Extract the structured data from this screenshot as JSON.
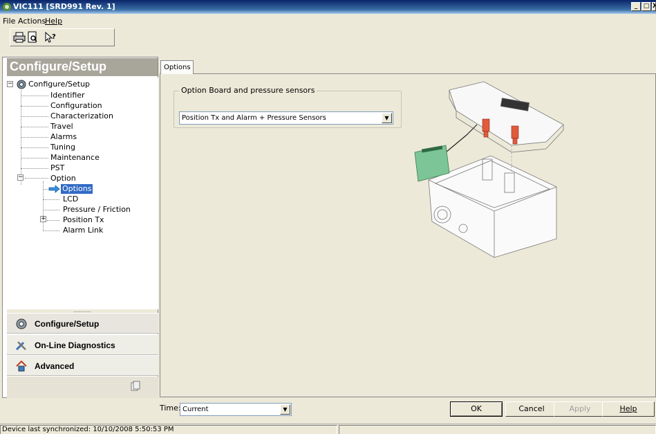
{
  "window": {
    "title": "VIC111 [SRD991 Rev. 1]",
    "minimize": "_",
    "maximize": "□",
    "close": "X"
  },
  "menu": {
    "file": "File",
    "actions": "Actions",
    "help": "Help"
  },
  "toolbar": {
    "print_icon": "printer-icon",
    "preview_icon": "print-preview-icon",
    "whatsthis_icon": "context-help-icon"
  },
  "left": {
    "header": "Configure/Setup",
    "tree": {
      "root": "Configure/Setup",
      "identifier": "Identifier",
      "configuration": "Configuration",
      "characterization": "Characterization",
      "travel": "Travel",
      "alarms": "Alarms",
      "tuning": "Tuning",
      "maintenance": "Maintenance",
      "pst": "PST",
      "option": "Option",
      "options": "Options",
      "lcd": "LCD",
      "pressure": "Pressure / Friction",
      "position_tx": "Position Tx",
      "alarm_link": "Alarm Link"
    },
    "splitter": "..........",
    "nav": {
      "configure": "Configure/Setup",
      "diagnostics": "On-Line Diagnostics",
      "advanced": "Advanced"
    }
  },
  "tab": {
    "options": "Options"
  },
  "group": {
    "label": "Option Board and pressure sensors",
    "select_value": "Position Tx and Alarm + Pressure Sensors"
  },
  "footer": {
    "time_label": "Time:",
    "time_value": "Current",
    "ok": "OK",
    "cancel": "Cancel",
    "apply": "Apply",
    "help": "Help"
  },
  "status": {
    "sync": "Device last synchronized: 10/10/2008 5:50:53 PM"
  },
  "colors": {
    "selection": "#316ac5",
    "board": "#7cc596",
    "sensor": "#e05a3c"
  }
}
